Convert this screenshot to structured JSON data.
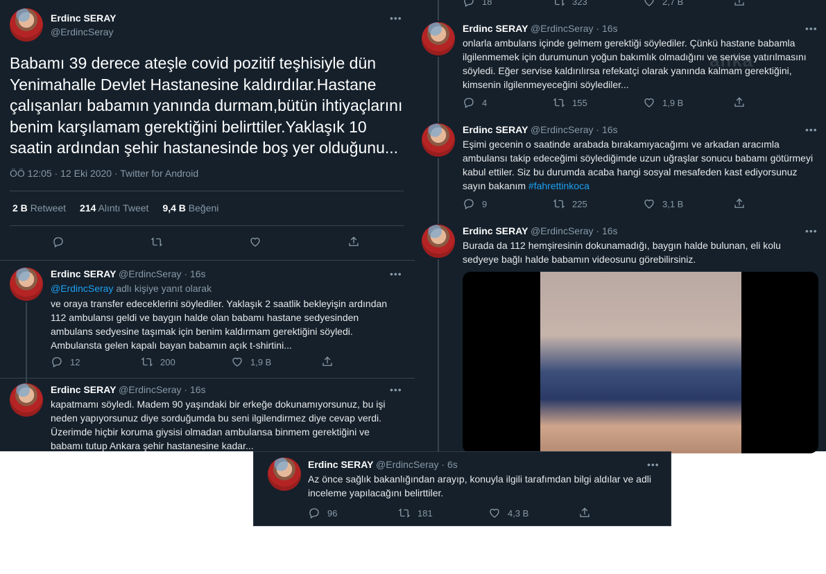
{
  "main_tweet": {
    "name": "Erdinc SERAY",
    "handle": "@ErdincSeray",
    "text": "Babamı 39 derece ateşle covid pozitif teşhisiyle dün Yenimahalle Devlet Hastanesine kaldırdılar.Hastane çalışanları babamın yanında durmam,bütün ihtiyaçlarını benim karşılamam gerektiğini belirttiler.Yaklaşık 10 saatin ardından şehir hastanesinde boş yer olduğunu...",
    "meta": "ÖÖ 12:05 · 12 Eki 2020 · Twitter for Android",
    "retweets_count": "2 B",
    "retweets_label": "Retweet",
    "quotes_count": "214",
    "quotes_label": "Alıntı Tweet",
    "likes_count": "9,4 B",
    "likes_label": "Beğeni"
  },
  "left_replies": [
    {
      "name": "Erdinc SERAY",
      "handle": "@ErdincSeray",
      "time": "· 16s",
      "reply_to_user": "@ErdincSeray",
      "reply_to_suffix": " adlı kişiye yanıt olarak",
      "text": "ve oraya transfer edeceklerini söylediler. Yaklaşık 2 saatlik bekleyişin ardından 112 ambulansı geldi ve baygın halde olan babamı hastane sedyesinden ambulans sedyesine taşımak için benim kaldırmam gerektiğini söyledi. Ambulansta gelen kapalı bayan babamın açık t-shirtini...",
      "replies": "12",
      "retweets": "200",
      "likes": "1,9 B"
    },
    {
      "name": "Erdinc SERAY",
      "handle": "@ErdincSeray",
      "time": "· 16s",
      "text": "kapatmamı söyledi. Madem 90 yaşındaki bir erkeğe dokunamıyorsunuz, bu işi neden yapıyorsunuz diye sorduğumda bu seni ilgilendirmez diye cevap verdi. Üzerimde hiçbir koruma giysisi olmadan ambulansa binmem gerektiğini ve babamı tutup Ankara şehir hastanesine kadar..."
    }
  ],
  "right_top_counts": {
    "replies": "18",
    "retweets": "323",
    "likes": "2,7 B"
  },
  "right_replies": [
    {
      "name": "Erdinc SERAY",
      "handle": "@ErdincSeray",
      "time": "· 16s",
      "text": "onlarla ambulans içinde gelmem gerektiği söylediler. Çünkü hastane babamla ilgilenmemek için durumunun yoğun bakımlık olmadığını ve servise yatırılmasını söyledi. Eğer servise kaldırılırsa refekatçi olarak yanında kalmam gerektiğini, kimsenin ilgilenmeyeceğini söylediler...",
      "replies": "4",
      "retweets": "155",
      "likes": "1,9 B"
    },
    {
      "name": "Erdinc SERAY",
      "handle": "@ErdincSeray",
      "time": "· 16s",
      "text": "Eşimi gecenin o saatinde arabada bırakamıyacağımı ve arkadan aracımla ambulansı takip edeceğimi söylediğimde uzun uğraşlar sonucu babamı götürmeyi kabul ettiler. Siz bu durumda acaba hangi sosyal mesafeden kast ediyorsunuz sayın bakanım ",
      "hashtag": "#fahrettinkoca",
      "replies": "9",
      "retweets": "225",
      "likes": "3,1 B"
    },
    {
      "name": "Erdinc SERAY",
      "handle": "@ErdincSeray",
      "time": "· 16s",
      "text": "Burada da 112 hemşiresinin dokunamadığı, baygın halde bulunan, eli kolu sedyeye bağlı halde babamın videosunu görebilirsiniz."
    }
  ],
  "watermark": "anka",
  "bottom_tweet": {
    "name": "Erdinc SERAY",
    "handle": "@ErdincSeray",
    "time": "· 6s",
    "text": "Az önce sağlık bakanlığından arayıp, konuyla ilgili tarafımdan bilgi aldılar ve adli inceleme yapılacağını belirttiler.",
    "replies": "96",
    "retweets": "181",
    "likes": "4,3 B"
  },
  "more_label": "•••",
  "colors": {
    "background": "#15202b",
    "accent": "#1da1f2",
    "muted": "#8899a6"
  }
}
